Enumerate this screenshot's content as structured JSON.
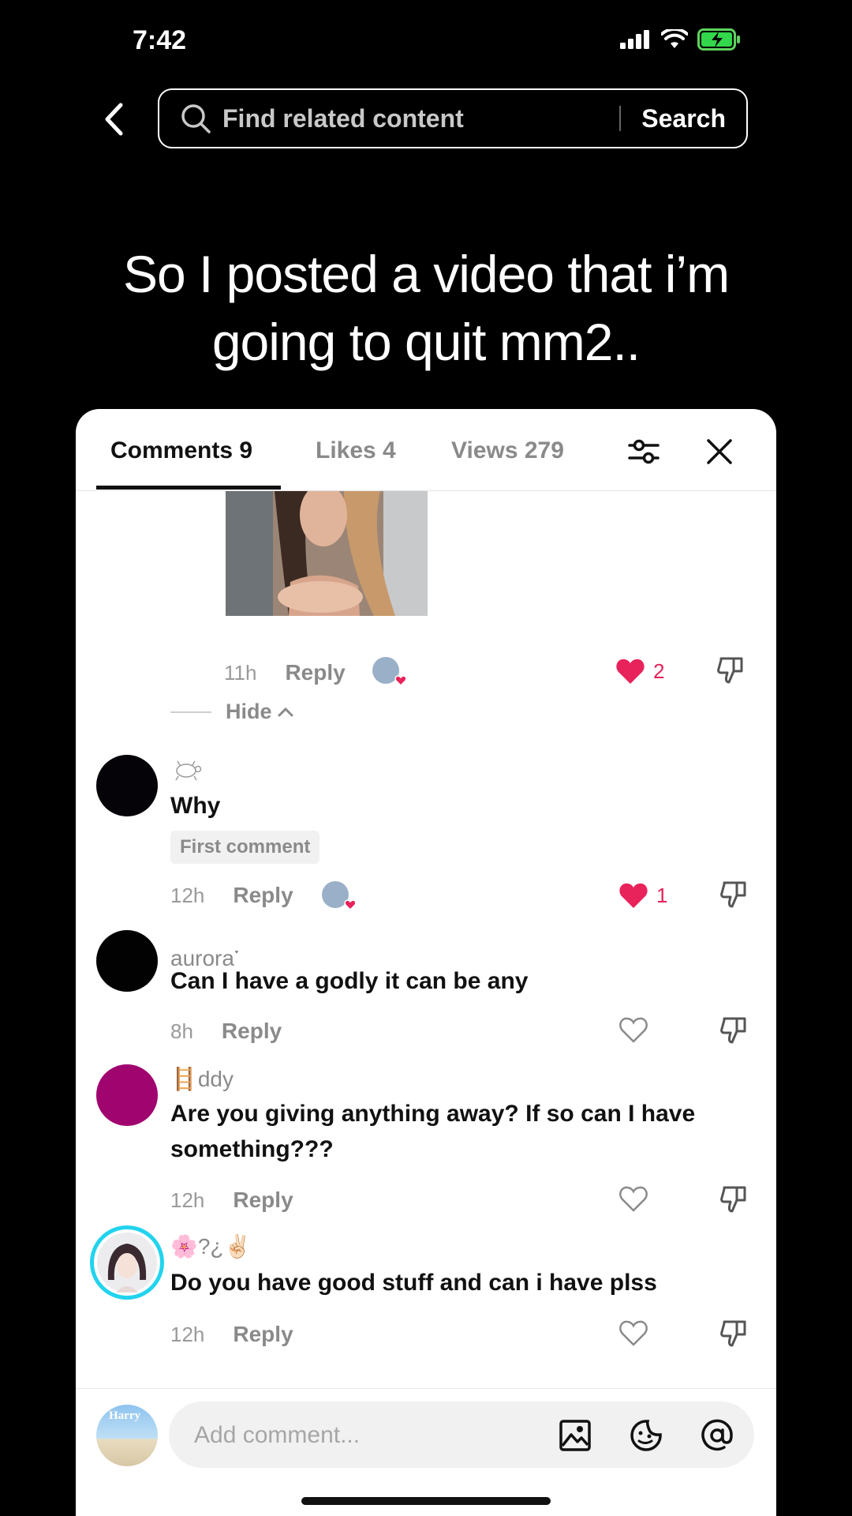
{
  "status_bar": {
    "time": "7:42"
  },
  "search": {
    "placeholder": "Find related content",
    "button_label": "Search"
  },
  "video": {
    "caption_line1": "So I posted a video that i’m",
    "caption_line2": "going to quit mm2.."
  },
  "tabs": [
    {
      "label": "Comments 9"
    },
    {
      "label": "Likes 4"
    },
    {
      "label": "Views 279"
    }
  ],
  "reply_thread": {
    "time": "11h",
    "reply_label": "Reply",
    "like_count": "2",
    "hide_label": "Hide"
  },
  "comments": [
    {
      "username": "",
      "text": "Why",
      "badge": "First comment",
      "time": "12h",
      "reply_label": "Reply",
      "like_count": "1",
      "liked": true
    },
    {
      "username": "aurora་",
      "text": "Can I have a godly it can be any",
      "time": "8h",
      "reply_label": "Reply",
      "liked": false
    },
    {
      "username": "🪜ddy",
      "text": "Are you giving anything away? If so can I have something???",
      "time": "12h",
      "reply_label": "Reply",
      "liked": false
    },
    {
      "username": "🌸?¿✌🏻",
      "text": "Do you have good stuff and can i have plss",
      "time": "12h",
      "reply_label": "Reply",
      "liked": false
    }
  ],
  "composer": {
    "placeholder": "Add comment...",
    "avatar_text": "Harry"
  },
  "colors": {
    "like_red": "#e8225a",
    "accent_teal": "#22d3ee",
    "avatar_purple": "#a0056f"
  }
}
